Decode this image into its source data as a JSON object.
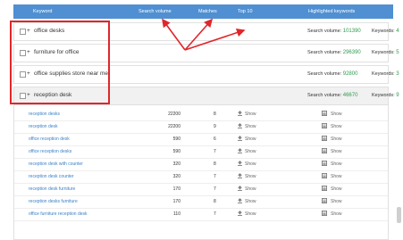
{
  "header": {
    "keyword": "Keyword",
    "search_volume": "Search volume",
    "matches": "Matches",
    "top10": "Top 10",
    "highlighted": "Highlighted keywords"
  },
  "groups": [
    {
      "plus": "+",
      "name": "office desks",
      "vol_label": "Search volume:",
      "vol": "101390",
      "kw_label": "Keywords:",
      "kw": "4"
    },
    {
      "plus": "+",
      "name": "furniture for office",
      "vol_label": "Search volume:",
      "vol": "296390",
      "kw_label": "Keywords:",
      "kw": "5"
    },
    {
      "plus": "+",
      "name": "office supplies store near me",
      "vol_label": "Search volume:",
      "vol": "92800",
      "kw_label": "Keywords:",
      "kw": "3"
    },
    {
      "plus": "+",
      "name": "reception desk",
      "vol_label": "Search volume:",
      "vol": "46670",
      "kw_label": "Keywords:",
      "kw": "9"
    }
  ],
  "rows": [
    {
      "keyword": "reception desks",
      "volume": "22200",
      "matches": "8",
      "show1": "Show",
      "show2": "Show"
    },
    {
      "keyword": "reception desk",
      "volume": "22200",
      "matches": "9",
      "show1": "Show",
      "show2": "Show"
    },
    {
      "keyword": "office reception desk",
      "volume": "590",
      "matches": "6",
      "show1": "Show",
      "show2": "Show"
    },
    {
      "keyword": "office reception desks",
      "volume": "590",
      "matches": "7",
      "show1": "Show",
      "show2": "Show"
    },
    {
      "keyword": "reception desk with counter",
      "volume": "320",
      "matches": "8",
      "show1": "Show",
      "show2": "Show"
    },
    {
      "keyword": "reception desk counter",
      "volume": "320",
      "matches": "7",
      "show1": "Show",
      "show2": "Show"
    },
    {
      "keyword": "reception desk furniture",
      "volume": "170",
      "matches": "7",
      "show1": "Show",
      "show2": "Show"
    },
    {
      "keyword": "reception desks furniture",
      "volume": "170",
      "matches": "8",
      "show1": "Show",
      "show2": "Show"
    },
    {
      "keyword": "office furniture reception desk",
      "volume": "110",
      "matches": "7",
      "show1": "Show",
      "show2": "Show"
    }
  ],
  "colors": {
    "header_bg": "#4f8fd2",
    "accent_green": "#2e9b4e",
    "link_blue": "#3a80c8",
    "annotation_red": "#e0262b"
  },
  "icons": [
    "upload-icon",
    "list-icon"
  ]
}
